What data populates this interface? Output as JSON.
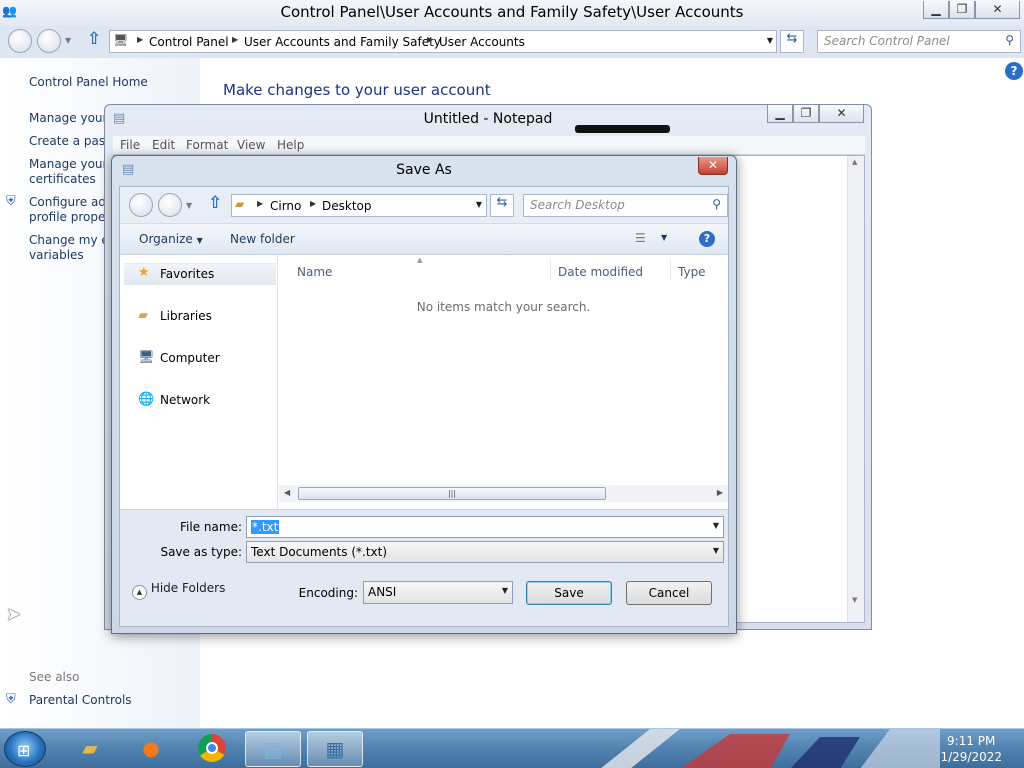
{
  "control_panel": {
    "title": "Control Panel\\User Accounts and Family Safety\\User Accounts",
    "breadcrumb": [
      "Control Panel",
      "User Accounts and Family Safety",
      "User Accounts"
    ],
    "search_placeholder": "Search Control Panel",
    "left_links": [
      "Control Panel Home",
      "Manage your c",
      "Create a passw",
      "Manage your f",
      "certificates",
      "Configure adv",
      "profile propert",
      "Change my en",
      "variables"
    ],
    "see_also": "See also",
    "parental_controls": "Parental Controls",
    "main_title": "Make changes to your user account"
  },
  "notepad": {
    "title": "Untitled - Notepad",
    "menu": [
      "File",
      "Edit",
      "Format",
      "View",
      "Help"
    ]
  },
  "save_as": {
    "title": "Save As",
    "breadcrumb": [
      "Cirno",
      "Desktop"
    ],
    "search_placeholder": "Search Desktop",
    "toolbar": {
      "organize": "Organize",
      "new_folder": "New folder"
    },
    "nav": [
      "Favorites",
      "Libraries",
      "Computer",
      "Network"
    ],
    "columns": [
      "Name",
      "Date modified",
      "Type"
    ],
    "empty_message": "No items match your search.",
    "file_name_label": "File name:",
    "file_name_value": "*.txt",
    "save_type_label": "Save as type:",
    "save_type_value": "Text Documents (*.txt)",
    "hide_folders": "Hide Folders",
    "encoding_label": "Encoding:",
    "encoding_value": "ANSI",
    "save_button": "Save",
    "cancel_button": "Cancel"
  },
  "taskbar": {
    "time": "9:11 PM",
    "date": "1/29/2022",
    "apps": [
      "folder-icon",
      "firefox-icon",
      "chrome-icon",
      "notepad-icon",
      "control-panel-icon"
    ]
  },
  "colors": {
    "link": "#1e3b64",
    "heading": "#1e3287",
    "selection": "#3399ff",
    "taskbar": "#5484b1"
  }
}
